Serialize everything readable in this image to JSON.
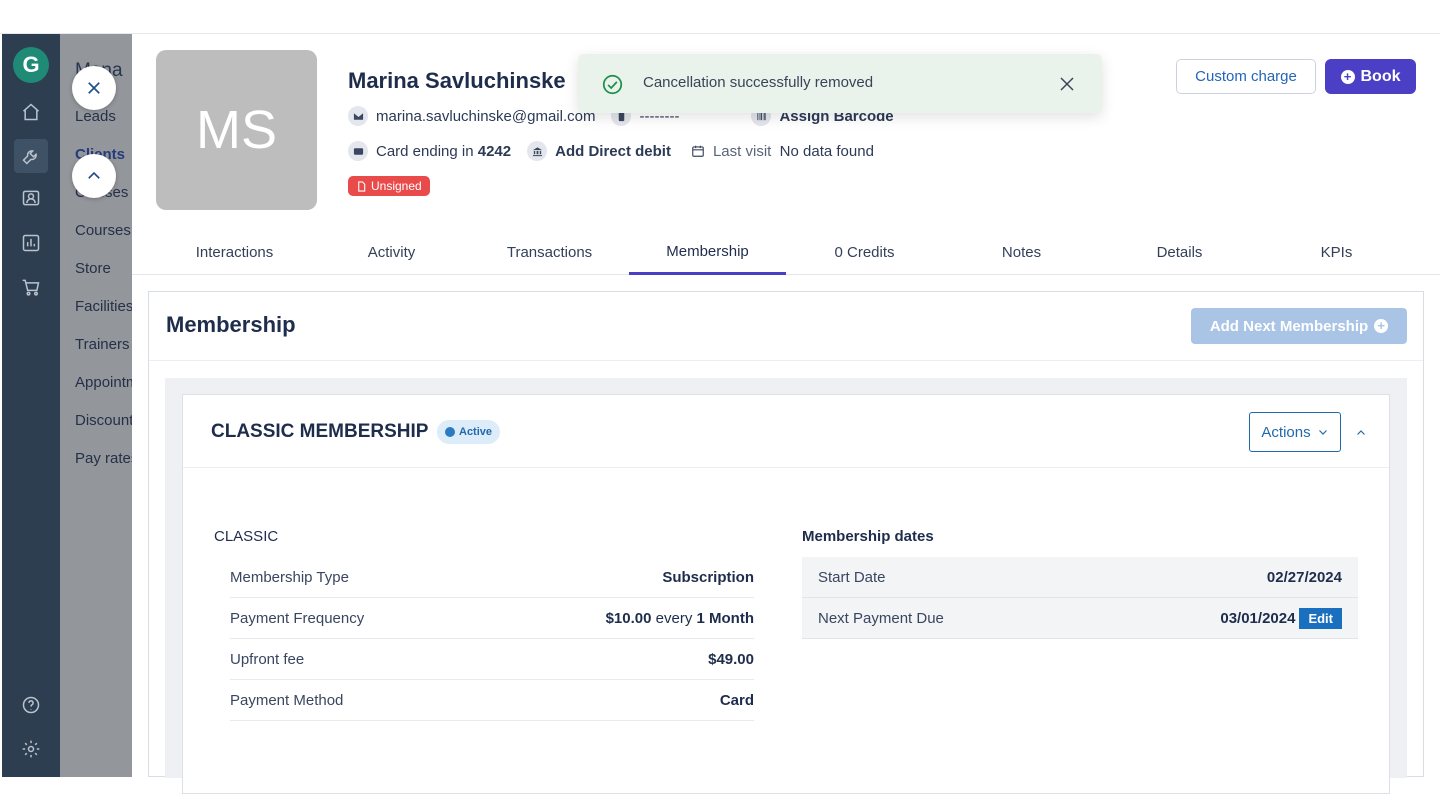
{
  "sidebar": {
    "logo_letter": "G",
    "icons": [
      "home-icon",
      "wrench-icon",
      "contacts-icon",
      "chart-icon",
      "cart-icon",
      "help-icon",
      "gear-icon"
    ]
  },
  "submenu": {
    "title": "Mana",
    "items": [
      "Leads",
      "Clients",
      "Classes",
      "Courses",
      "Store",
      "Facilities",
      "Trainers",
      "Appointm",
      "Discounts",
      "Pay rates"
    ]
  },
  "client": {
    "initials": "MS",
    "name": "Marina Savluchinske",
    "email": "marina.savluchinske@gmail.com",
    "phone": "--------",
    "barcode_label": "Assign Barcode",
    "card_prefix": "Card ending in",
    "card_last4": "4242",
    "direct_debit_label": "Add Direct debit",
    "last_visit_label": "Last visit",
    "last_visit_value": "No data found",
    "waiver_badge": "Unsigned"
  },
  "header_actions": {
    "custom_charge": "Custom charge",
    "book": "Book"
  },
  "toast": {
    "message": "Cancellation successfully removed"
  },
  "tabs": [
    "Interactions",
    "Activity",
    "Transactions",
    "Membership",
    "0 Credits",
    "Notes",
    "Details",
    "KPIs"
  ],
  "active_tab": "Membership",
  "membership_panel": {
    "title": "Membership",
    "add_next_label": "Add Next Membership",
    "card": {
      "title": "CLASSIC MEMBERSHIP",
      "status": "Active",
      "actions_label": "Actions",
      "plan_name": "CLASSIC",
      "details": {
        "type_label": "Membership Type",
        "type_value": "Subscription",
        "freq_label": "Payment Frequency",
        "freq_amount": "$10.00",
        "freq_every": "every",
        "freq_period": "1 Month",
        "upfront_label": "Upfront fee",
        "upfront_value": "$49.00",
        "method_label": "Payment Method",
        "method_value": "Card"
      },
      "dates": {
        "title": "Membership dates",
        "start_label": "Start Date",
        "start_value": "02/27/2024",
        "next_label": "Next Payment Due",
        "next_value": "03/01/2024",
        "edit_label": "Edit"
      }
    }
  }
}
